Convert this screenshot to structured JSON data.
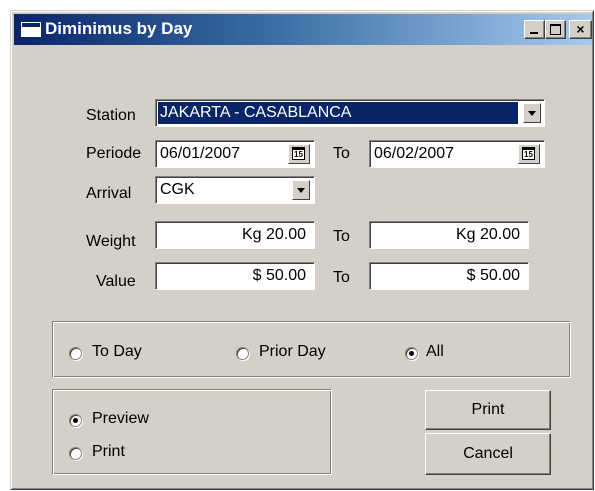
{
  "window": {
    "title": "Diminimus by Day",
    "title_icon": "window-icon",
    "buttons": {
      "minimize_icon": "minimize-icon",
      "maximize_icon": "maximize-icon",
      "close_glyph": "×"
    }
  },
  "form": {
    "station": {
      "label": "Station",
      "value": "JAKARTA - CASABLANCA"
    },
    "periode": {
      "label": "Periode",
      "from": "06/01/2007",
      "to_label": "To",
      "to": "06/02/2007",
      "calendar_glyph": "15"
    },
    "arrival": {
      "label": "Arrival",
      "value": "CGK"
    },
    "weight": {
      "label": "Weight",
      "from": "Kg 20.00",
      "to_label": "To",
      "to": "Kg 20.00"
    },
    "value": {
      "label": "Value",
      "from": "$ 50.00",
      "to_label": "To",
      "to": "$ 50.00"
    }
  },
  "day_options": {
    "items": [
      {
        "label": "To Day",
        "selected": false
      },
      {
        "label": "Prior Day",
        "selected": false
      },
      {
        "label": "All",
        "selected": true
      }
    ]
  },
  "output_options": {
    "items": [
      {
        "label": "Preview",
        "selected": true
      },
      {
        "label": "Print",
        "selected": false
      }
    ]
  },
  "actions": {
    "print_label": "Print",
    "cancel_label": "Cancel"
  },
  "colors": {
    "window_bg": "#d4d0c8",
    "titlebar_start": "#0a246a",
    "titlebar_end": "#a6caf0",
    "selection_bg": "#0a246a"
  }
}
